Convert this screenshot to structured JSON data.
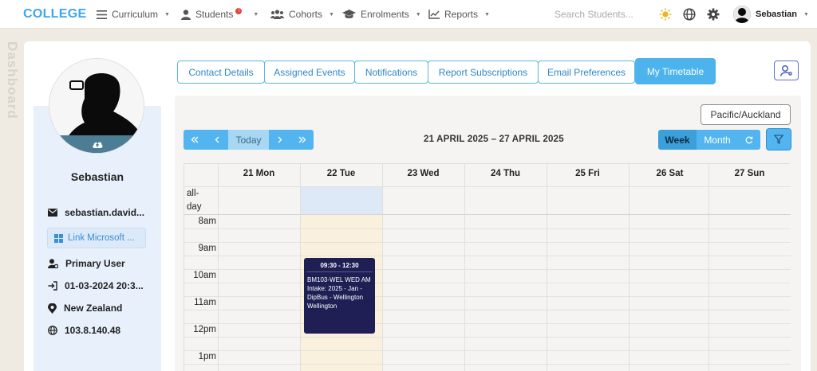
{
  "nav": {
    "logo": "COLLEGE",
    "items": [
      {
        "label": "Curriculum"
      },
      {
        "label": "Students",
        "badge": "!"
      },
      {
        "label": "Cohorts"
      },
      {
        "label": "Enrolments"
      },
      {
        "label": "Reports"
      }
    ],
    "search_placeholder": "Search Students...",
    "user": "Sebastian"
  },
  "side_label": "Dashboard",
  "profile": {
    "name": "Sebastian",
    "email": "sebastian.david...",
    "microsoft_button": "Link Microsoft ...",
    "role": "Primary User",
    "last_login": "01-03-2024 20:3...",
    "country": "New Zealand",
    "ip": "103.8.140.48"
  },
  "tabs": [
    "Contact Details",
    "Assigned Events",
    "Notifications",
    "Report Subscriptions",
    "Email Preferences",
    "My Timetable"
  ],
  "calendar": {
    "timezone": "Pacific/Auckland",
    "today_label": "Today",
    "date_range": "21 APRIL 2025 – 27 APRIL 2025",
    "week_label": "Week",
    "month_label": "Month",
    "days": [
      "21 Mon",
      "22 Tue",
      "23 Wed",
      "24 Thu",
      "25 Fri",
      "26 Sat",
      "27 Sun"
    ],
    "allday_label": "all-day",
    "times": [
      "8am",
      "9am",
      "10am",
      "11am",
      "12pm",
      "1pm"
    ],
    "event": {
      "time": "09:30 - 12:30",
      "title": "BM103-WEL WED AM",
      "details": "Intake: 2025 - Jan - DipBus - Wellington",
      "location": "Wellington"
    }
  },
  "colors": {
    "accent": "#4cb3ec",
    "logo": "#3ba6f0",
    "event_bg": "#1f1f55",
    "today_bg": "#f9f1dd"
  }
}
